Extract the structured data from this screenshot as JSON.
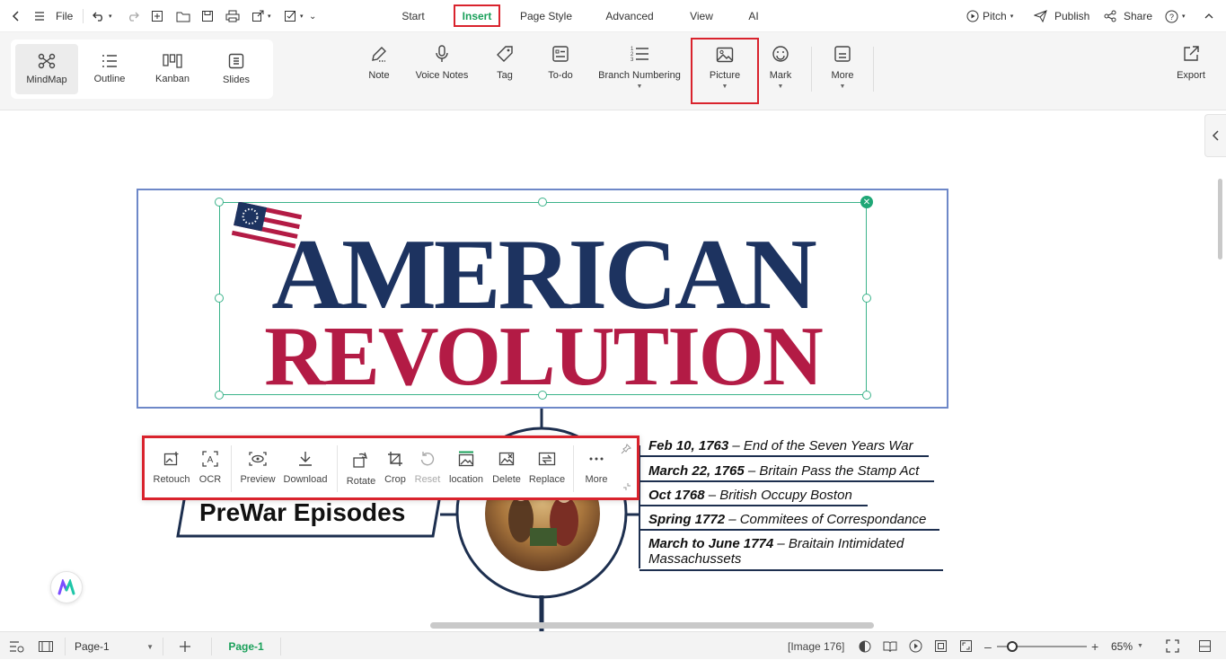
{
  "titlebar": {
    "file_label": "File",
    "tabs": [
      {
        "label": "Start"
      },
      {
        "label": "Insert"
      },
      {
        "label": "Page Style"
      },
      {
        "label": "Advanced"
      },
      {
        "label": "View"
      },
      {
        "label": "AI"
      }
    ],
    "pitch_label": "Pitch",
    "publish_label": "Publish",
    "share_label": "Share"
  },
  "ribbon": {
    "views": [
      {
        "label": "MindMap"
      },
      {
        "label": "Outline"
      },
      {
        "label": "Kanban"
      },
      {
        "label": "Slides"
      }
    ],
    "tools": [
      {
        "label": "Note"
      },
      {
        "label": "Voice Notes"
      },
      {
        "label": "Tag"
      },
      {
        "label": "To-do"
      },
      {
        "label": "Branch Numbering"
      },
      {
        "label": "Picture"
      },
      {
        "label": "Mark"
      },
      {
        "label": "More"
      }
    ],
    "export_label": "Export"
  },
  "canvas": {
    "title_line1": "AMERICAN",
    "title_line2": "REVOLUTION",
    "topic": "PreWar Episodes",
    "image_toolbar": [
      {
        "label": "Retouch"
      },
      {
        "label": "OCR"
      },
      {
        "label": "Preview"
      },
      {
        "label": "Download"
      },
      {
        "label": "Rotate"
      },
      {
        "label": "Crop"
      },
      {
        "label": "Reset"
      },
      {
        "label": "location"
      },
      {
        "label": "Delete"
      },
      {
        "label": "Replace"
      },
      {
        "label": "More"
      }
    ],
    "events": [
      {
        "date": "Feb 10, 1763",
        "text": " – End of the Seven Years War"
      },
      {
        "date": "March 22, 1765",
        "text": " – Britain Pass the Stamp Act"
      },
      {
        "date": "Oct 1768",
        "text": " – British Occupy Boston"
      },
      {
        "date": "Spring 1772",
        "text": " – Commitees of Correspondance"
      },
      {
        "date": "March to June 1774",
        "text": " – Braitain Intimidated",
        "text2": "Massachussets"
      }
    ]
  },
  "statusbar": {
    "page_select": "Page-1",
    "page_tab": "Page-1",
    "selection_info": "[Image 176]",
    "zoom": "65%"
  },
  "colors": {
    "accent_green": "#1aa05a",
    "highlight_red": "#d9232d",
    "navy": "#1d3360",
    "crimson": "#b31b45"
  }
}
